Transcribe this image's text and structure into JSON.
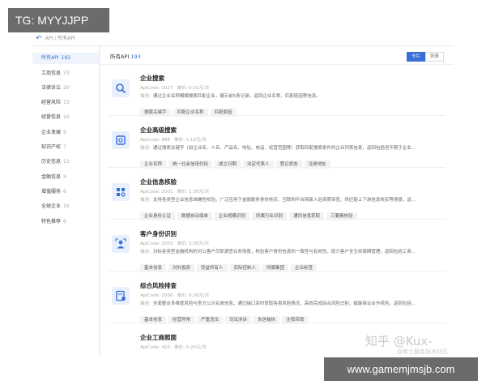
{
  "watermarks": {
    "top_left": "TG: MYYJJPP",
    "bottom_right": "www.gamemjmsjb.com",
    "zhihu": "知乎 @Kux-",
    "zhihu_sub": "@稀土掘金技术社区"
  },
  "breadcrumb": {
    "back_icon": "back-arrow-icon",
    "text": "API / 所有API"
  },
  "sidebar": {
    "items": [
      {
        "label": "所有API",
        "count": "193",
        "active": true
      },
      {
        "label": "工商信息",
        "count": "33"
      },
      {
        "label": "法律诉讼",
        "count": "20"
      },
      {
        "label": "经营风险",
        "count": "13"
      },
      {
        "label": "经营信息",
        "count": "16"
      },
      {
        "label": "企业发展",
        "count": "9"
      },
      {
        "label": "知识产权",
        "count": "7"
      },
      {
        "label": "历史信息",
        "count": "13"
      },
      {
        "label": "金融信息",
        "count": "4"
      },
      {
        "label": "增值服务",
        "count": "6"
      },
      {
        "label": "全球企业",
        "count": "16"
      },
      {
        "label": "特色推荐",
        "count": "6"
      }
    ]
  },
  "main": {
    "title": "所有API",
    "count": "193",
    "view_grid": "卡片",
    "view_list": "列表",
    "desc_label": "描述:",
    "cards": [
      {
        "icon": "search-icon",
        "name": "企业搜索",
        "apicode": "ApiCode: 1027",
        "price": "单价: 0.01元/次",
        "desc": "通过企业名称模糊搜索匹配企业，展示前5条记录，返回企业名称、匹配原因等信息。",
        "tags": [
          "搜索关键字",
          "匹配企业名称",
          "匹配原因"
        ]
      },
      {
        "icon": "advanced-search-icon",
        "name": "企业高级搜索",
        "apicode": "ApiCode: 886",
        "price": "单价: 0.10元/次",
        "desc": "通过搜索关键字（如企业名、人名、产品名、地址、电话、经营范围等）获取匹配搜索条件的企业列表信息，返回包括但不限于企业...",
        "tags": [
          "企业名称",
          "统一社会信用代码",
          "成立日期",
          "法定代表人",
          "登记状态",
          "注册地址"
        ]
      },
      {
        "icon": "verify-icon",
        "name": "企业信息核验",
        "apicode": "ApiCode: 2001",
        "price": "单价: 1.00元/次",
        "desc": "支持各类型企业信息准确性校验。广泛应用于金融服务身份核实、互联网平台商家入驻资质审查、供应链上下游信息核实等场景，返...",
        "tags": [
          "企业身份认证",
          "数据自动填单",
          "企业规模识别",
          "所属行业识别",
          "通讯信息获取",
          "三要素核验"
        ]
      },
      {
        "icon": "person-id-icon",
        "name": "客户身份识别",
        "apicode": "ApiCode: 2003",
        "price": "单价: 3.00元/次",
        "desc": "对标各类型金融机构的对公客户尽职调查业务场景，核验客户身份信息的一致性与有效性，助力客户全生命周期管理，返回包括工商...",
        "tags": [
          "基本信息",
          "对外投资",
          "受益所有人",
          "实际控制人",
          "所属集团",
          "企业标签"
        ]
      },
      {
        "icon": "risk-check-icon",
        "name": "综合风险排查",
        "apicode": "ApiCode: 2006",
        "price": "单价: 6.00元/次",
        "desc": "全面整合多维度风险与官方公示名单信息，通过接口实时获取各类风险情况，高效完成综合风险识别，赋能商业合作风险，返回包括...",
        "tags": [
          "基本信息",
          "经营异常",
          "严重违法",
          "司法涉诉",
          "失信被执",
          "注销吊销"
        ]
      },
      {
        "icon": "license-icon",
        "name": "企业工商照面",
        "apicode": "ApiCode: 410",
        "price": "单价: 0.20元/次",
        "desc": "",
        "tags": []
      }
    ]
  },
  "colors": {
    "accent": "#3a6fd8",
    "watermark_bg": "#6b6b6b"
  }
}
